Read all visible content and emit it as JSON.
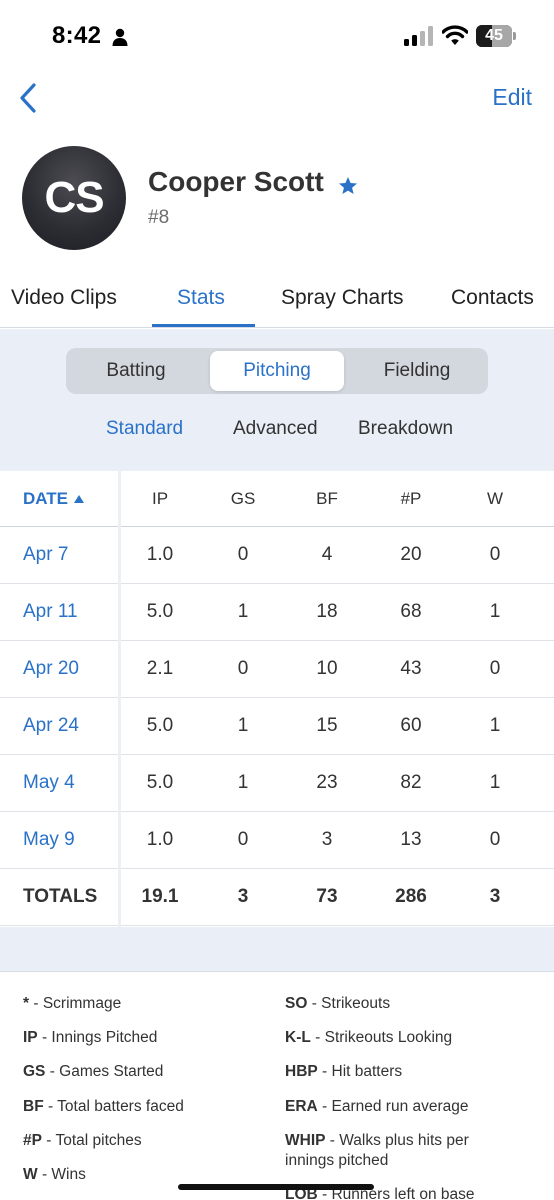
{
  "status_bar": {
    "time": "8:42",
    "battery": "45",
    "battery_level": 0.45
  },
  "nav": {
    "edit_label": "Edit",
    "back_icon": "chevron-left-icon"
  },
  "profile": {
    "initials": "CS",
    "name": "Cooper Scott",
    "number": "#8",
    "favorite_icon": "star-icon"
  },
  "tabs": [
    {
      "label": "Video Clips"
    },
    {
      "label": "Stats",
      "active": true
    },
    {
      "label": "Spray Charts"
    },
    {
      "label": "Contacts"
    }
  ],
  "segments": [
    {
      "label": "Batting"
    },
    {
      "label": "Pitching",
      "active": true
    },
    {
      "label": "Fielding"
    }
  ],
  "subtabs": [
    {
      "label": "Standard",
      "active": true
    },
    {
      "label": "Advanced"
    },
    {
      "label": "Breakdown"
    }
  ],
  "table": {
    "columns": [
      "DATE",
      "IP",
      "GS",
      "BF",
      "#P",
      "W"
    ],
    "rows": [
      [
        "Apr 7",
        "1.0",
        "0",
        "4",
        "20",
        "0"
      ],
      [
        "Apr 11",
        "5.0",
        "1",
        "18",
        "68",
        "1"
      ],
      [
        "Apr 20",
        "2.1",
        "0",
        "10",
        "43",
        "0"
      ],
      [
        "Apr 24",
        "5.0",
        "1",
        "15",
        "60",
        "1"
      ],
      [
        "May 4",
        "5.0",
        "1",
        "23",
        "82",
        "1"
      ],
      [
        "May 9",
        "1.0",
        "0",
        "3",
        "13",
        "0"
      ]
    ],
    "totals": [
      "TOTALS",
      "19.1",
      "3",
      "73",
      "286",
      "3"
    ]
  },
  "legend": {
    "left": [
      {
        "abbr": "*",
        "desc": " - Scrimmage"
      },
      {
        "abbr": "IP",
        "desc": " - Innings Pitched"
      },
      {
        "abbr": "GS",
        "desc": " - Games Started"
      },
      {
        "abbr": "BF",
        "desc": " - Total batters faced"
      },
      {
        "abbr": "#P",
        "desc": " - Total pitches"
      },
      {
        "abbr": "W",
        "desc": " - Wins"
      }
    ],
    "right": [
      {
        "abbr": "SO",
        "desc": " - Strikeouts"
      },
      {
        "abbr": "K-L",
        "desc": " - Strikeouts Looking"
      },
      {
        "abbr": "HBP",
        "desc": " - Hit batters"
      },
      {
        "abbr": "ERA",
        "desc": " - Earned run average"
      },
      {
        "abbr": "WHIP",
        "desc": " - Walks plus hits per innings pitched"
      },
      {
        "abbr": "LOB",
        "desc": " - Runners left on base"
      }
    ]
  },
  "colors": {
    "accent": "#2a72c8",
    "panel": "#e9eef7"
  }
}
